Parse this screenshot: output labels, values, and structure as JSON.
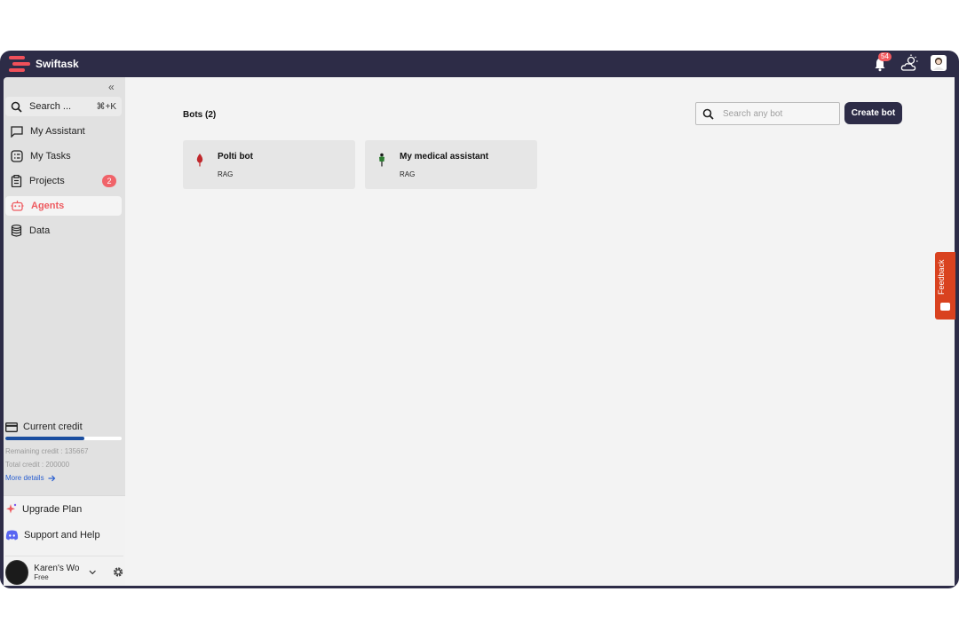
{
  "app": {
    "name": "Swiftask",
    "brand_color": "#f0505a",
    "header_color": "#2d2c47"
  },
  "header": {
    "notifications_count": "54",
    "icons": [
      "bell-icon",
      "weather-icon",
      "avatar"
    ]
  },
  "sidebar": {
    "collapse_icon": "double-chevron-left-icon",
    "search": {
      "label": "Search ...",
      "shortcut": "⌘+K"
    },
    "items": [
      {
        "label": "My Assistant",
        "icon": "chat-icon"
      },
      {
        "label": "My Tasks",
        "icon": "tasks-icon"
      },
      {
        "label": "Projects",
        "icon": "clipboard-icon",
        "badge": "2"
      },
      {
        "label": "Agents",
        "icon": "robot-icon",
        "active": true
      },
      {
        "label": "Data",
        "icon": "database-icon"
      }
    ],
    "credit": {
      "title": "Current credit",
      "remaining_label": "Remaining credit : 135667",
      "total_label": "Total credit : 200000",
      "remaining_fraction": 0.678,
      "more_label": "More details"
    },
    "upgrade_label": "Upgrade Plan",
    "support_label": "Support and Help",
    "user": {
      "name": "Karen's Wo",
      "plan": "Free"
    }
  },
  "main": {
    "title": "Bots (2)",
    "search_placeholder": "Search any bot",
    "create_label": "Create bot",
    "bots": [
      {
        "name": "Polti bot",
        "type": "RAG",
        "icon_color": "#c0282c"
      },
      {
        "name": "My medical assistant",
        "type": "RAG",
        "icon_color": "#2e7d32"
      }
    ]
  },
  "feedback": {
    "label": "Feedback",
    "color": "#d9421f"
  }
}
